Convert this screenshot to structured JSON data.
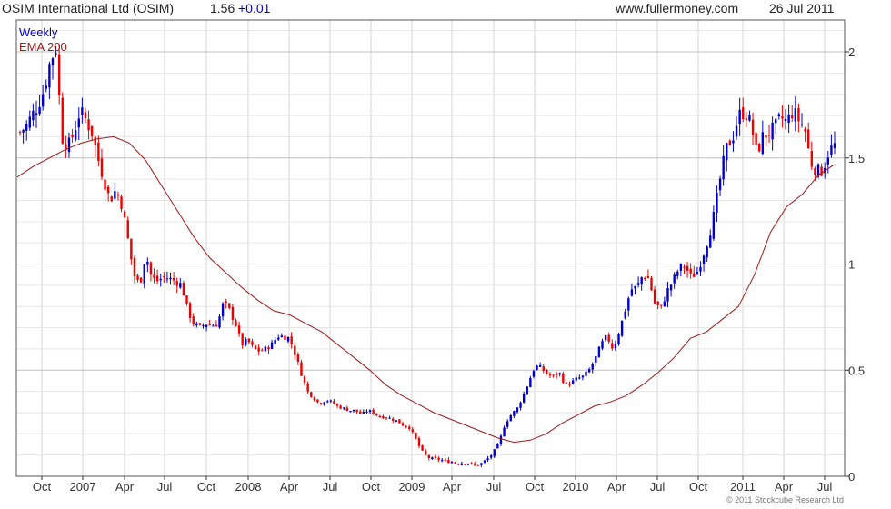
{
  "header": {
    "title": "OSIM International Ltd (OSIM)",
    "price": "1.56",
    "change": "+0.01",
    "site": "www.fullermoney.com",
    "date": "26 Jul 2011"
  },
  "legend": {
    "period": "Weekly",
    "ema": "EMA 200"
  },
  "copyright": "© 2011 Stockcube Research Ltd",
  "colors": {
    "up": "#0000cc",
    "down": "#ee0000",
    "ema": "#a01818",
    "grid": "#d4d4d4",
    "axis": "#333333"
  },
  "chart_data": {
    "type": "candlestick",
    "x_labels": [
      "Oct",
      "2007",
      "Apr",
      "Jul",
      "Oct",
      "2008",
      "Apr",
      "Jul",
      "Oct",
      "2009",
      "Apr",
      "Jul",
      "Oct",
      "2010",
      "Apr",
      "Jul",
      "Oct",
      "2011",
      "Apr",
      "Jul"
    ],
    "y_ticks": [
      "0",
      "0.5",
      "1",
      "1.5",
      "2"
    ],
    "ylim": [
      0,
      2.15
    ],
    "close_series": [
      1.62,
      1.65,
      1.7,
      1.75,
      1.82,
      1.95,
      2.02,
      1.6,
      1.55,
      1.62,
      1.72,
      1.68,
      1.62,
      1.5,
      1.4,
      1.3,
      1.35,
      1.28,
      1.12,
      0.95,
      0.9,
      1.05,
      0.93,
      0.92,
      0.94,
      0.93,
      0.92,
      0.9,
      0.78,
      0.72,
      0.7,
      0.72,
      0.71,
      0.72,
      0.82,
      0.78,
      0.72,
      0.62,
      0.64,
      0.6,
      0.59,
      0.6,
      0.62,
      0.66,
      0.66,
      0.65,
      0.57,
      0.48,
      0.4,
      0.37,
      0.34,
      0.36,
      0.35,
      0.33,
      0.32,
      0.31,
      0.31,
      0.29,
      0.31,
      0.3,
      0.28,
      0.28,
      0.27,
      0.26,
      0.24,
      0.23,
      0.18,
      0.12,
      0.09,
      0.08,
      0.08,
      0.07,
      0.07,
      0.06,
      0.065,
      0.06,
      0.05,
      0.06,
      0.08,
      0.11,
      0.16,
      0.25,
      0.29,
      0.32,
      0.38,
      0.45,
      0.52,
      0.51,
      0.48,
      0.47,
      0.49,
      0.43,
      0.44,
      0.46,
      0.47,
      0.5,
      0.55,
      0.62,
      0.66,
      0.6,
      0.68,
      0.78,
      0.88,
      0.89,
      0.95,
      0.93,
      0.81,
      0.79,
      0.87,
      0.92,
      0.98,
      0.99,
      0.94,
      0.96,
      1.04,
      1.13,
      1.25,
      1.42,
      1.55,
      1.6,
      1.7,
      1.72,
      1.66,
      1.52,
      1.6,
      1.62,
      1.64,
      1.69,
      1.67,
      1.72,
      1.68,
      1.64,
      1.48,
      1.44,
      1.44,
      1.53,
      1.56
    ],
    "ema200_series": [
      1.41,
      1.46,
      1.5,
      1.54,
      1.57,
      1.59,
      1.6,
      1.57,
      1.49,
      1.37,
      1.25,
      1.13,
      1.03,
      0.96,
      0.89,
      0.83,
      0.78,
      0.76,
      0.72,
      0.68,
      0.62,
      0.56,
      0.5,
      0.43,
      0.38,
      0.34,
      0.3,
      0.27,
      0.24,
      0.21,
      0.18,
      0.16,
      0.17,
      0.2,
      0.25,
      0.29,
      0.33,
      0.35,
      0.38,
      0.43,
      0.49,
      0.56,
      0.65,
      0.68,
      0.74,
      0.8,
      0.95,
      1.15,
      1.27,
      1.33,
      1.42,
      1.47
    ]
  }
}
